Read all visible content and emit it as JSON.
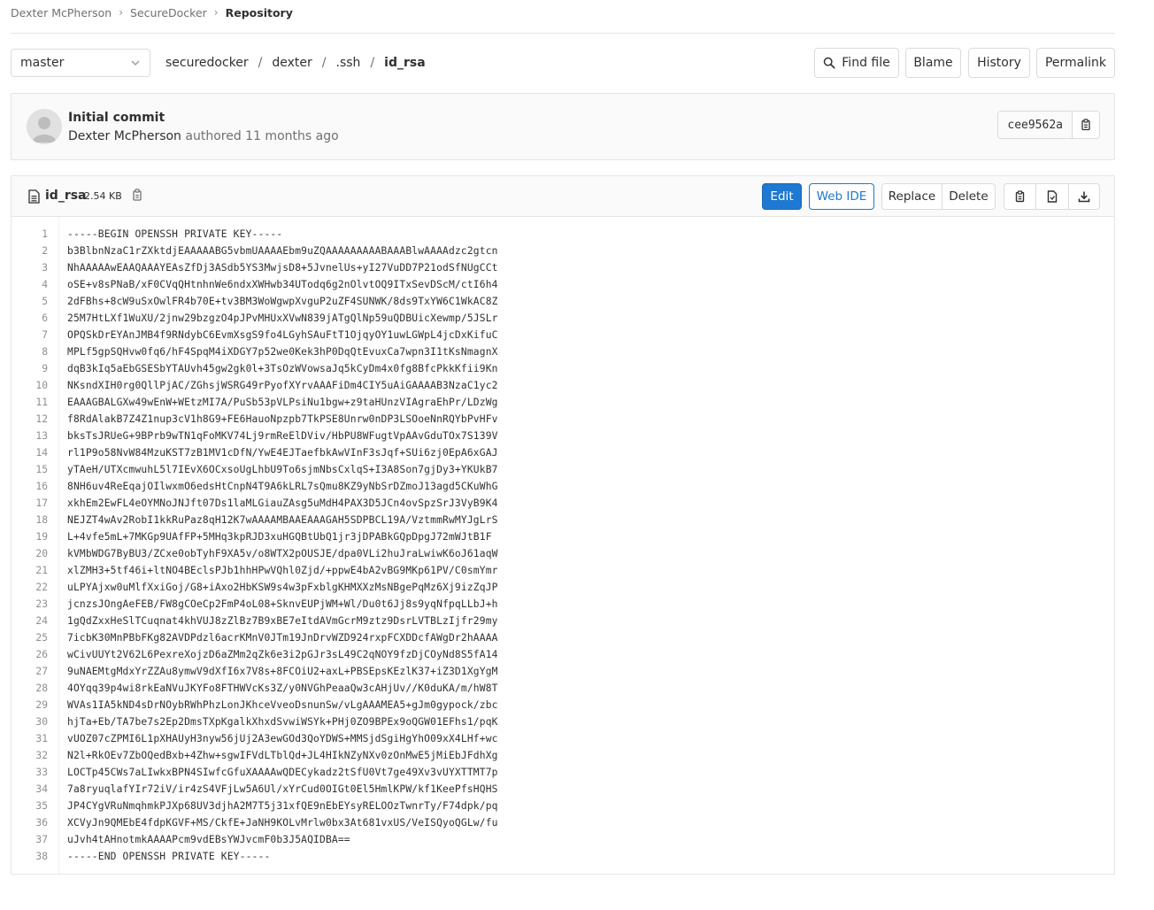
{
  "breadcrumb": {
    "items": [
      "Dexter McPherson",
      "SecureDocker",
      "Repository"
    ]
  },
  "branch": {
    "selected": "master"
  },
  "path": {
    "segments": [
      "securedocker",
      "dexter",
      ".ssh",
      "id_rsa"
    ]
  },
  "actions": {
    "find_file": "Find file",
    "blame": "Blame",
    "history": "History",
    "permalink": "Permalink"
  },
  "commit": {
    "title": "Initial commit",
    "author": "Dexter McPherson",
    "authored_text": "authored",
    "time": "11 months ago",
    "sha": "cee9562a"
  },
  "file": {
    "name": "id_rsa",
    "size": "2.54 KB",
    "edit": "Edit",
    "web_ide": "Web IDE",
    "replace": "Replace",
    "delete": "Delete",
    "lines": [
      "-----BEGIN OPENSSH PRIVATE KEY-----",
      "b3BlbnNzaC1rZXktdjEAAAAABG5vbmUAAAAEbm9uZQAAAAAAAAABAAABlwAAAAdzc2gtcn",
      "NhAAAAAwEAAQAAAYEAsZfDj3ASdb5YS3MwjsD8+5JvnelUs+yI27VuDD7P21odSfNUgCCt",
      "oSE+v8sPNaB/xF0CVqQHtnhnWe6ndxXWHwb34UTodq6g2nOlvtOQ9ITxSevDScM/ctI6h4",
      "2dFBhs+8cW9uSxOwlFR4b70E+tv3BM3WoWgwpXvguP2uZF4SUNWK/8ds9TxYW6C1WkAC8Z",
      "25M7HtLXf1WuXU/2jnw29bzgzO4pJPvMHUxXVwN839jATgQlNp59uQDBUicXewmp/5JSLr",
      "OPQSkDrEYAnJMB4f9RNdybC6EvmXsgS9fo4LGyhSAuFtT1OjqyOY1uwLGWpL4jcDxKifuC",
      "MPLf5gpSQHvw0fq6/hF4SpqM4iXDGY7p52we0Kek3hP0DqQtEvuxCa7wpn3I1tKsNmagnX",
      "dqB3kIq5aEbGSESbYTAUvh45gw2gk0l+3TsOzWVowsaJq5kCyDm4x0fg8BfcPkkKfii9Kn",
      "NKsndXIH0rg0QllPjAC/ZGhsjWSRG49rPyofXYrvAAAFiDm4CIY5uAiGAAAAB3NzaC1yc2",
      "EAAAGBALGXw49wEnW+WEtzMI7A/PuSb53pVLPsiNu1bgw+z9taHUnzVIAgraEhPr/LDzWg",
      "f8RdAlakB7Z4Z1nup3cV1h8G9+FE6HauoNpzpb7TkPSE8Unrw0nDP3LSOoeNnRQYbPvHFv",
      "bksTsJRUeG+9BPrb9wTN1qFoMKV74Lj9rmReElDViv/HbPU8WFugtVpAAvGduTOx7S139V",
      "rl1P9o58NvW84MzuKST7zB1MV1cDfN/YwE4EJTaefbkAwVInF3sJqf+SUi6zj0EpA6xGAJ",
      "yTAeH/UTXcmwuhL5l7IEvX6OCxsoUgLhbU9To6sjmNbsCxlqS+I3A8Son7gjDy3+YKUkB7",
      "8NH6uv4ReEqajOIlwxmO6edsHtCnpN4T9A6kLRL7sQmu8KZ9yNbSrDZmoJ13agd5CKuWhG",
      "xkhEm2EwFL4eOYMNoJNJft07Ds1laMLGiauZAsg5uMdH4PAX3D5JCn4ovSpzSrJ3VyB9K4",
      "NEJZT4wAv2RobI1kkRuPaz8qH12K7wAAAAMBAAEAAAGAH5SDPBCL19A/VztmmRwMYJgLrS",
      "L+4vfe5mL+7MKGp9UAfFP+5MHq3kpRJD3xuHGQBtUbQ1jr3jDPABkGQpDpgJ72mWJtB1F",
      "kVMbWDG7ByBU3/ZCxe0obTyhF9XA5v/o8WTX2pOUSJE/dpa0VLi2huJraLwiwK6oJ61aqW",
      "xlZMH3+5tf46i+ltNO4BEclsPJb1hhHPwVQhl0Zjd/+ppwE4bA2vBG9MKp61PV/C0smYmr",
      "uLPYAjxw0uMlfXxiGoj/G8+iAxo2HbKSW9s4w3pFxblgKHMXXzMsNBgePqMz6Xj9izZqJP",
      "jcnzsJOngAeFEB/FW8gCOeCp2FmP4oL08+SknvEUPjWM+Wl/Du0t6Jj8s9yqNfpqLLbJ+h",
      "1gQdZxxHeSlTCuqnat4khVUJ8zZlBz7B9xBE7eItdAVmGcrM9ztz9DsrLVTBLzIjfr29my",
      "7icbK30MnPBbFKg82AVDPdzl6acrKMnV0JTm19JnDrvWZD924rxpFCXDDcfAWgDr2hAAAA",
      "wCivUUYt2V62L6PexreXojzD6aZMm2qZk6e3i2pGJr3sL49C2qNOY9fzDjCOyNd8S5fA14",
      "9uNAEMtgMdxYrZZAu8ymwV9dXfI6x7V8s+8FCOiU2+axL+PBSEpsKEzlK37+iZ3D1XgYgM",
      "4OYqq39p4wi8rkEaNVuJKYFo8FTHWVcKs3Z/y0NVGhPeaaQw3cAHjUv//K0duKA/m/hW8T",
      "WVAs1IA5kND4sDrNOybRWhPhzLonJKhceVveoDsnunSw/vLgAAAMEA5+gJm0gypock/zbc",
      "hjTa+Eb/TA7be7s2Ep2DmsTXpKgalkXhxdSvwiWSYk+PHj0ZO9BPEx9oQGW01EFhs1/pqK",
      "vUOZ07cZPMI6L1pXHAUyH3nyw56jUj2A3ewGOd3QoYDWS+MMSjdSgiHgYhO09xX4LHf+wc",
      "N2l+RkOEv7ZbOQedBxb+4Zhw+sgwIFVdLTblQd+JL4HIkNZyNXv0zOnMwE5jMiEbJFdhXg",
      "LOCTp45CWs7aLIwkxBPN4SIwfcGfuXAAAAwQDECykadz2tSfU0Vt7ge49Xv3vUYXTTMT7p",
      "7a8ryuqlafYIr72iV/ir4zS4VFjLw5A6Ul/xYrCud0OIGt0El5HmlKPW/kf1KeePfsHQHS",
      "JP4CYgVRuNmqhmkPJXp68UV3djhA2M7T5j31xfQE9nEbEYsyRELOOzTwnrTy/F74dpk/pq",
      "XCVyJn9QMEbE4fdpKGVF+MS/CkfE+JaNH9KOLvMrlw0bx3At681vxUS/VeISQyoQGLw/fu",
      "uJvh4tAHnotmkAAAAPcm9vdEBsYWJvcmF0b3J5AQIDBA==",
      "-----END OPENSSH PRIVATE KEY-----"
    ]
  }
}
